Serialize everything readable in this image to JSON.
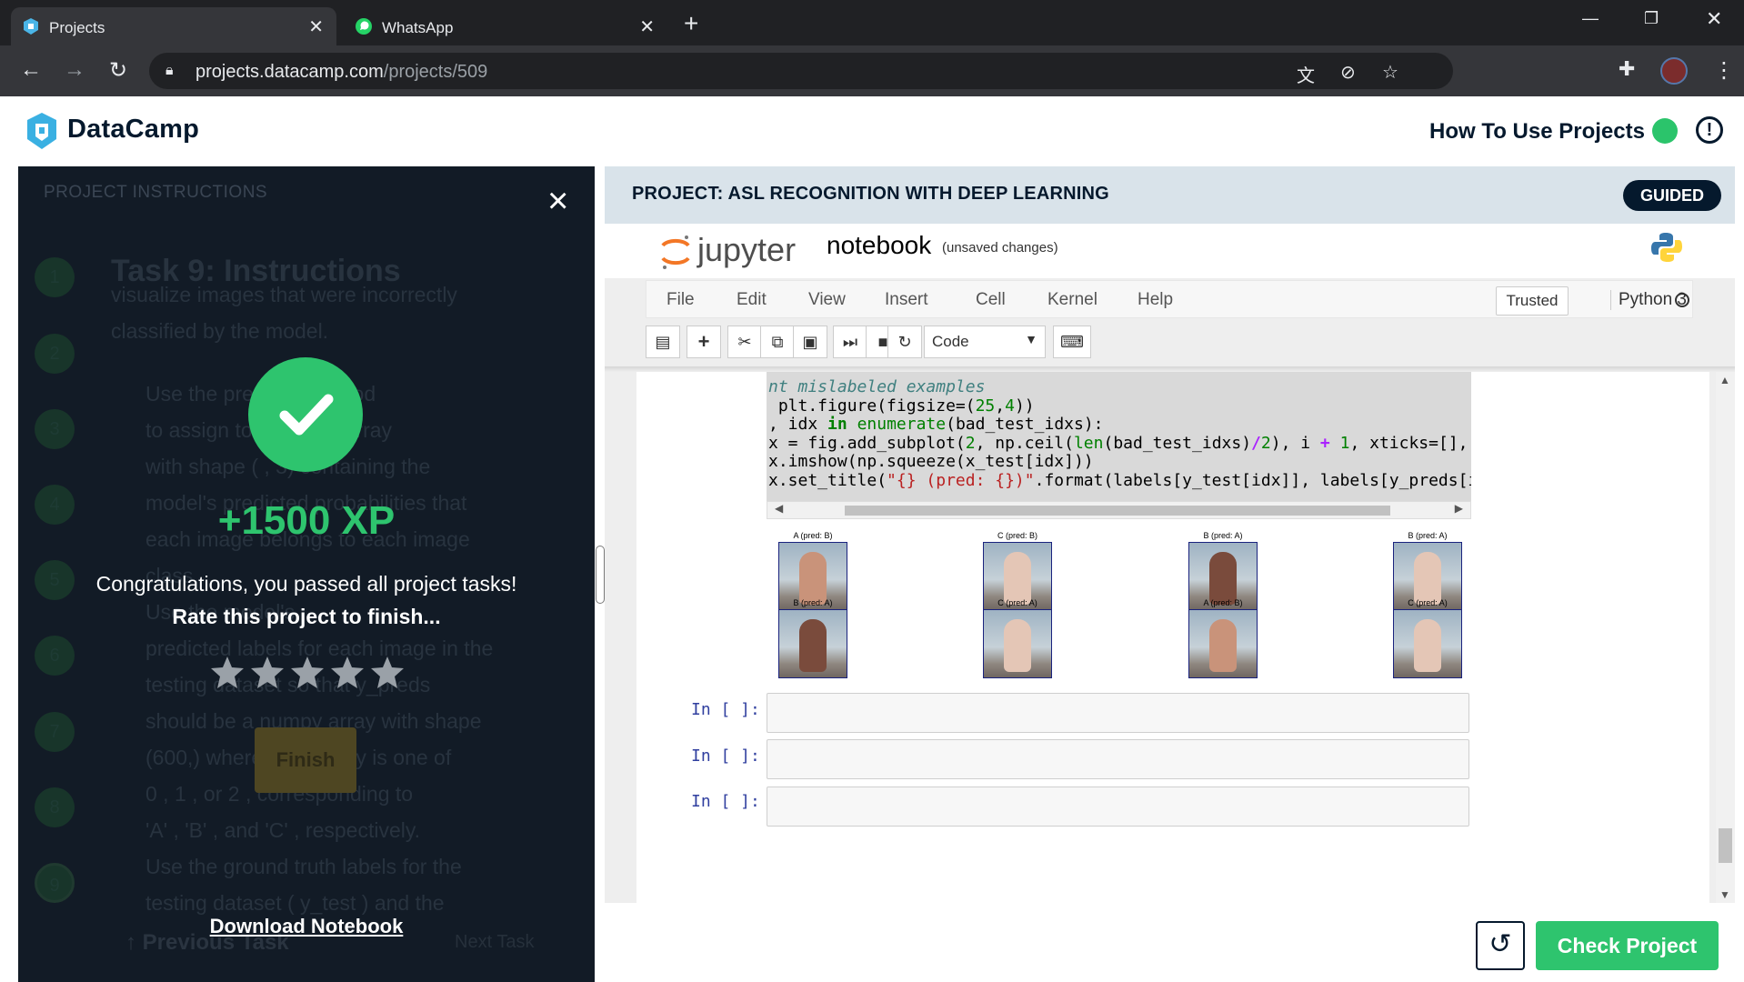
{
  "browser": {
    "tabs": [
      {
        "title": "Projects",
        "active": true,
        "icon": "datacamp-shield-icon"
      },
      {
        "title": "WhatsApp",
        "active": false,
        "icon": "whatsapp-icon"
      }
    ],
    "url_host": "projects.datacamp.com",
    "url_path": "/projects/509"
  },
  "header": {
    "logo": "DataCamp",
    "how_to": "How To Use Projects",
    "status_color": "#2bc46b",
    "alert_glyph": "!"
  },
  "instructions": {
    "header": "PROJECT INSTRUCTIONS",
    "steps": [
      "1",
      "2",
      "3",
      "4",
      "5",
      "6",
      "7",
      "8",
      "9"
    ],
    "title": "Task 9: Instructions",
    "lines": [
      "visualize images that were incorrectly",
      "classified by the model."
    ],
    "bullets": [
      "Use the           predict()   method",
      "to assign              to a numpy array",
      "with shape  (  ,  3)   containing the",
      "model's predicted probabilities that",
      "each image belongs to each image",
      "class.",
      "Use the                  model's",
      "predicted labels for each image in the",
      "testing dataset so that   y_preds",
      "should be a numpy array with shape",
      "(600,)    where each entry is one of",
      "0 ,  1 , or  2 , corresponding to",
      "'A' ,  'B' , and  'C' , respectively.",
      "Use the ground truth labels for the",
      "testing dataset (  y_test  ) and the"
    ],
    "prev_task": "Previous Task",
    "next_task": "Next Task"
  },
  "modal": {
    "close_glyph": "×",
    "xp": "+1500 XP",
    "congrats": "Congratulations, you passed all project tasks!",
    "rate": "Rate this project to finish...",
    "rating": 0,
    "rating_max": 5,
    "finish": "Finish",
    "download": "Download Notebook",
    "accent": "#2ec46e"
  },
  "project": {
    "title": "PROJECT: ASL RECOGNITION WITH DEEP LEARNING",
    "badge": "GUIDED"
  },
  "jupyter": {
    "logo_text": "jupyter",
    "notebook": "notebook",
    "unsaved": "(unsaved changes)",
    "menu": [
      "File",
      "Edit",
      "View",
      "Insert",
      "Cell",
      "Kernel",
      "Help"
    ],
    "trusted": "Trusted",
    "kernel": "Python 3",
    "cell_type": "Code",
    "toolbar_icons": [
      "save-icon",
      "plus-icon",
      "cut-icon",
      "copy-icon",
      "paste-icon",
      "run-icon",
      "stop-icon",
      "restart-icon",
      "keyboard-icon"
    ]
  },
  "code": {
    "l1_comment": "nt mislabeled examples",
    "l2a": " plt.figure(figsize=(",
    "l2n1": "25",
    "l2b": ",",
    "l2n2": "4",
    "l2c": "))",
    "l3a": ", idx ",
    "l3kw": "in",
    "l3b": " ",
    "l3bi": "enumerate",
    "l3c": "(bad_test_idxs):",
    "l4a": "x = fig.add_subplot(",
    "l4n1": "2",
    "l4b": ", np.ceil(",
    "l4bi": "len",
    "l4c": "(bad_test_idxs)",
    "l4op1": "/",
    "l4n2": "2",
    "l4d": "), i ",
    "l4op2": "+",
    "l4e": " ",
    "l4n3": "1",
    "l4f": ", xticks=[], yticks=[])",
    "l5": "x.imshow(np.squeeze(x_test[idx]))",
    "l6a": "x.set_title(",
    "l6str": "\"{} (pred: {})\"",
    "l6b": ".format(labels[y_test[idx]], labels[y_preds[idx]]))"
  },
  "outputs": {
    "row1": [
      "A (pred: B)",
      "C (pred: B)",
      "B (pred: A)",
      "B (pred: A)"
    ],
    "row2": [
      "B (pred: A)",
      "C (pred: A)",
      "A (pred: B)",
      "C (pred: A)"
    ],
    "tones": [
      [
        "mid",
        "light",
        "dark",
        "light"
      ],
      [
        "dark",
        "light",
        "mid",
        "light"
      ]
    ]
  },
  "cells": {
    "prompt": "In [ ]:"
  },
  "footer": {
    "check": "Check Project",
    "undo_glyph": "↺"
  }
}
